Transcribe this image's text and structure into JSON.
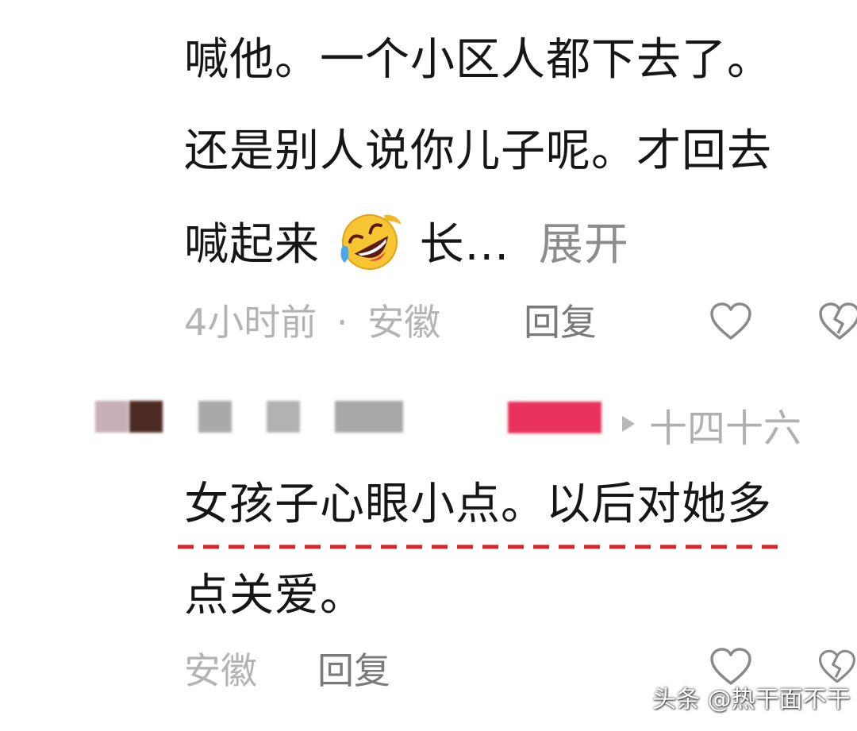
{
  "comment1": {
    "lines": [
      "喊他。一个小区人都下去了。",
      "还是别人说你儿子呢。才回去",
      "喊起来"
    ],
    "emoji": "rofl-emoji",
    "truncated_text": "长...",
    "expand_label": "展开",
    "time": "4小时前",
    "separator": "·",
    "location": "安徽",
    "reply_label": "回复"
  },
  "comment2": {
    "username_suffix": "十四十六",
    "lines": [
      "女孩子心眼小点。以后对她多",
      "点关爱。"
    ],
    "underline_color": "#d8262c",
    "location": "安徽",
    "reply_label": "回复"
  },
  "icons": {
    "like": "heart-outline-icon",
    "dislike": "broken-heart-icon",
    "reply_arrow": "triangle-right-icon"
  },
  "colors": {
    "text": "#161616",
    "meta": "#b3b3b3",
    "reply": "#7a7a7a",
    "accent_red": "#e8315b"
  },
  "watermark": "头条 @热干面不干"
}
